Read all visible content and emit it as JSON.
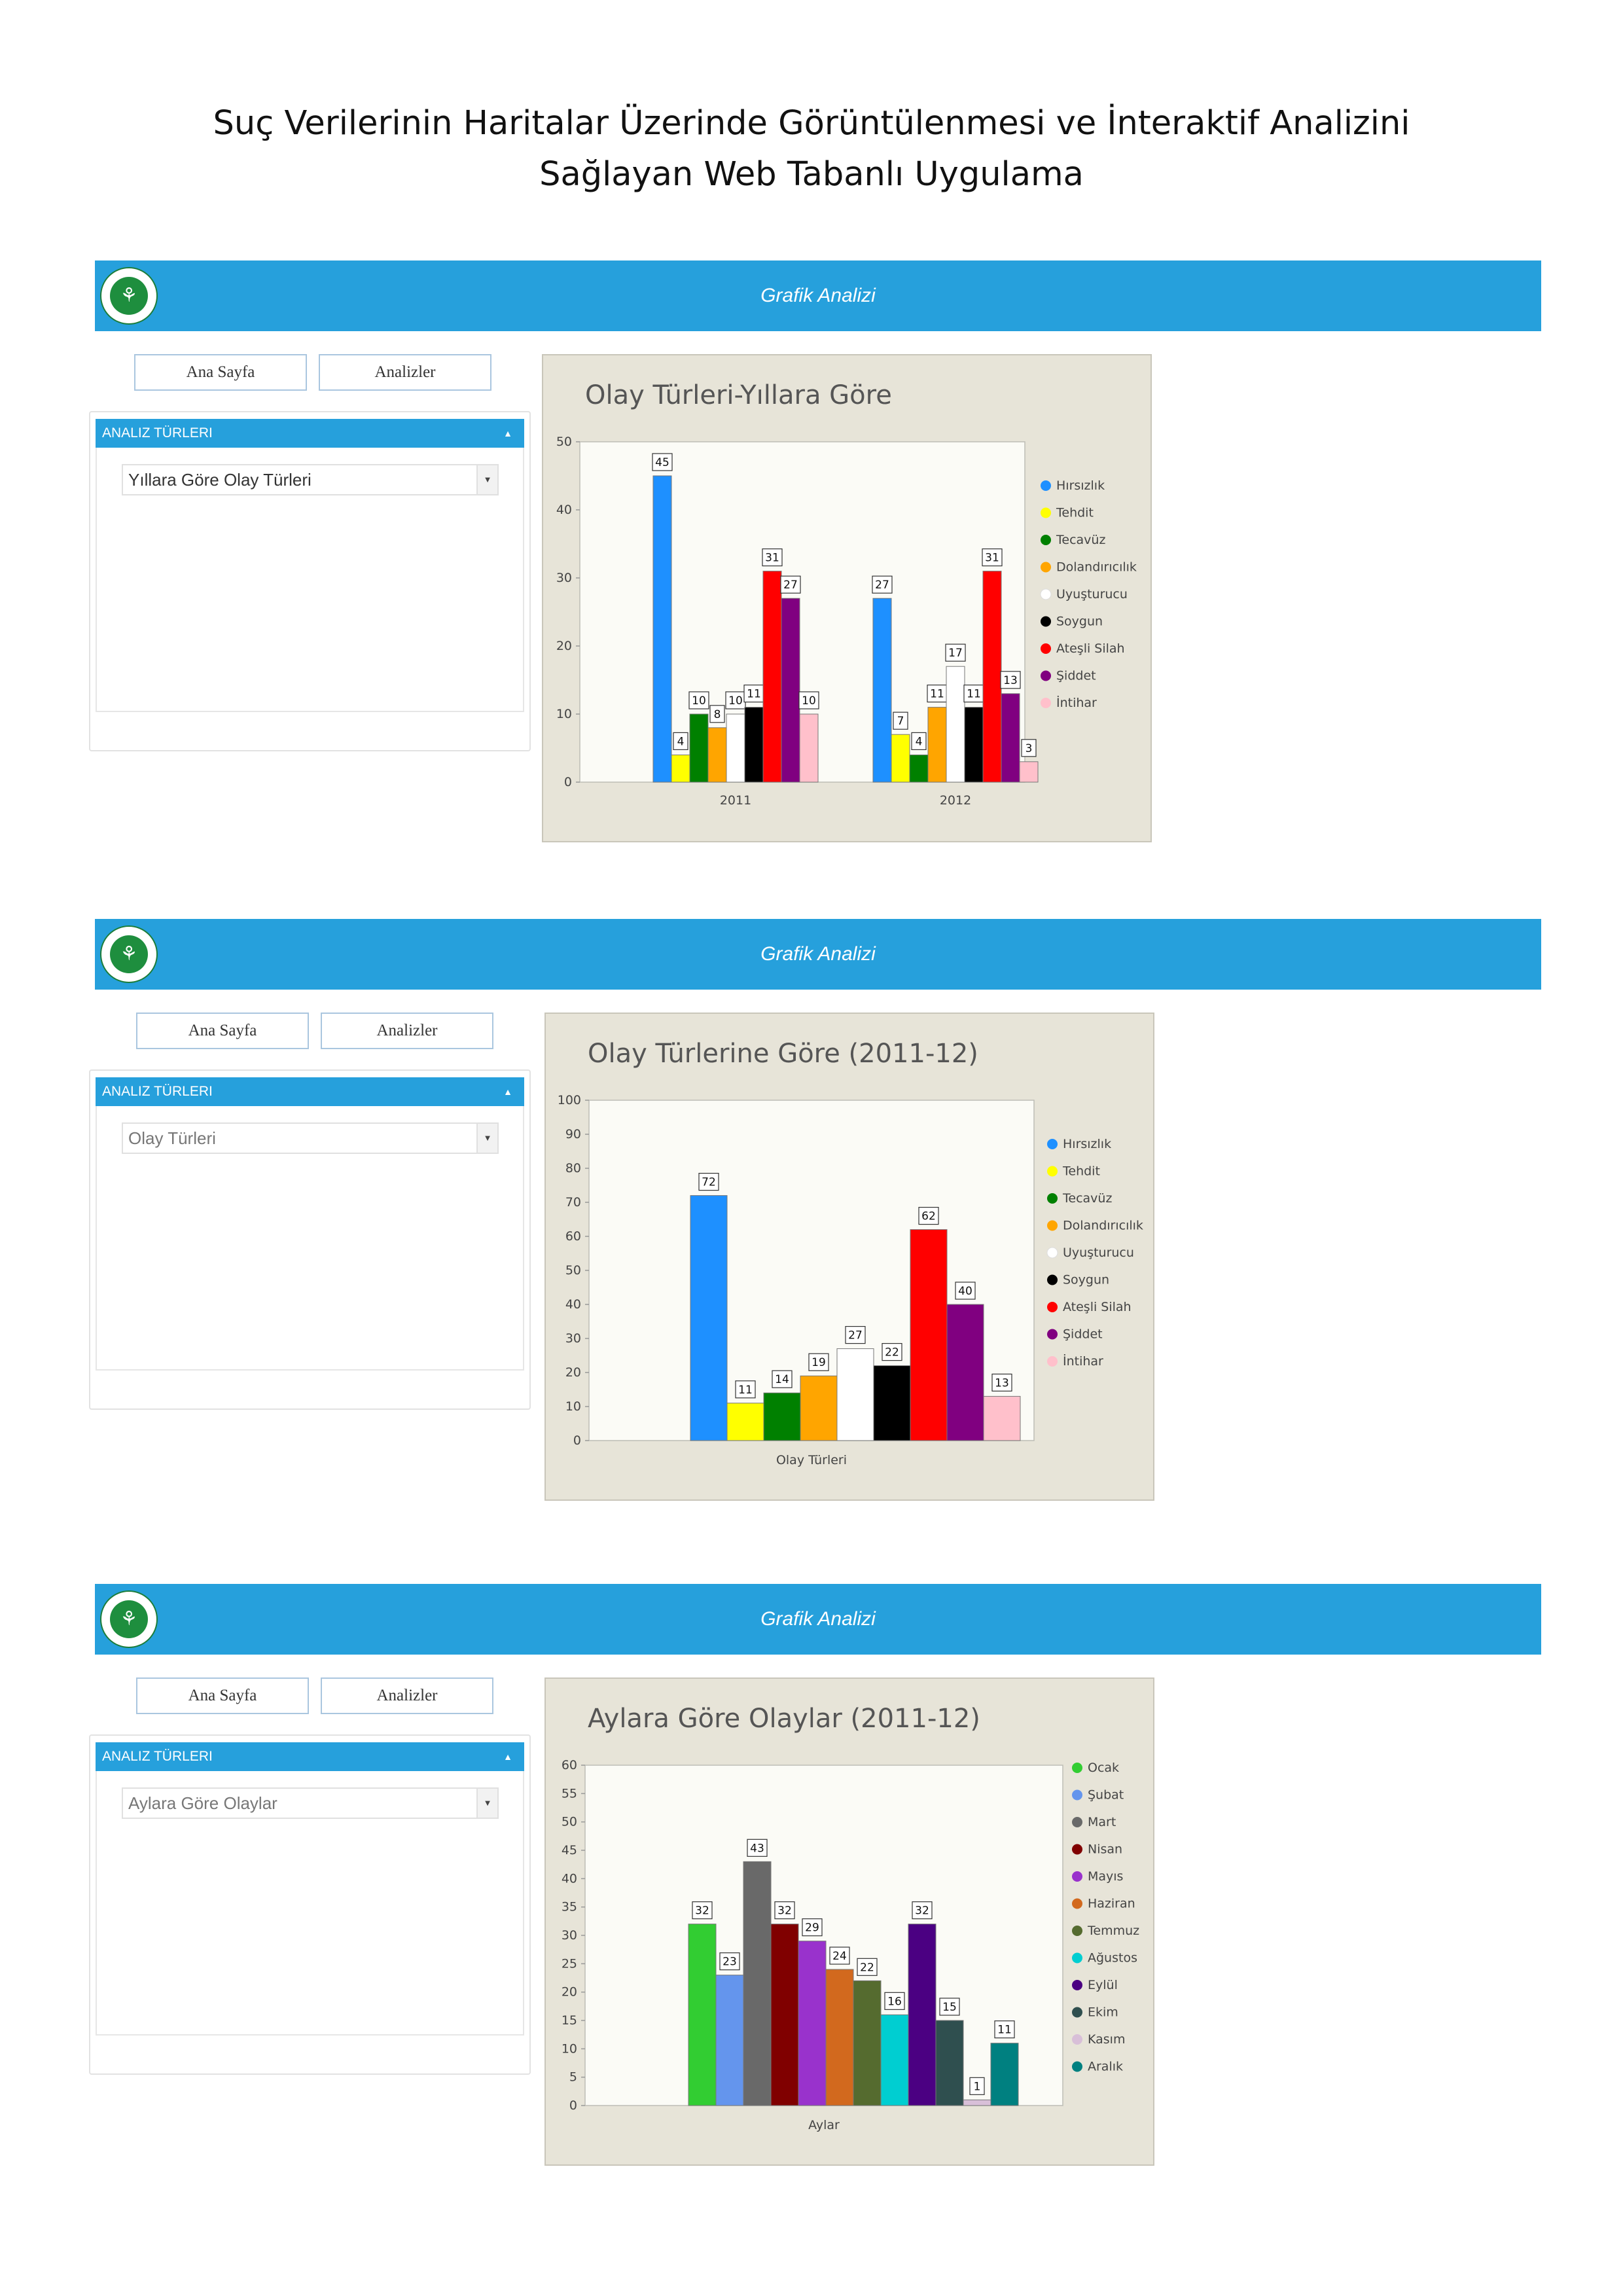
{
  "document": {
    "title_line1": "Suç Verilerinin Haritalar Üzerinde Görüntülenmesi ve İnteraktif Analizini",
    "title_line2": "Sağlayan Web Tabanlı Uygulama"
  },
  "colors": {
    "topbar": "#26a0dc",
    "sidebar_header": "#26a0dc",
    "chart_panel_bg": "#e7e4d8",
    "plot_bg": "#fbfbf6"
  },
  "icons": {
    "logo": "university-seal-icon"
  },
  "screens": [
    {
      "header_title": "Grafik Analizi",
      "nav": {
        "home_label": "Ana Sayfa",
        "analyses_label": "Analizler"
      },
      "sidebar": {
        "header": "ANALIZ TÜRLERI",
        "selected": "Yıllara Göre Olay Türleri"
      }
    },
    {
      "header_title": "Grafik Analizi",
      "nav": {
        "home_label": "Ana Sayfa",
        "analyses_label": "Analizler"
      },
      "sidebar": {
        "header": "ANALIZ TÜRLERI",
        "selected": "Olay Türleri"
      }
    },
    {
      "header_title": "Grafik Analizi",
      "nav": {
        "home_label": "Ana Sayfa",
        "analyses_label": "Analizler"
      },
      "sidebar": {
        "header": "ANALIZ TÜRLERI",
        "selected": "Aylara Göre Olaylar"
      }
    }
  ],
  "chart_data": [
    {
      "type": "bar",
      "title": "Olay Türleri-Yıllara Göre",
      "xlabel": "",
      "ylabel": "",
      "ylim": [
        0,
        50
      ],
      "yticks": [
        0,
        10,
        20,
        30,
        40,
        50
      ],
      "categories": [
        "2011",
        "2012"
      ],
      "legend_position": "right",
      "data_labels": true,
      "series": [
        {
          "name": "Hırsızlık",
          "color": "#1e90ff",
          "values": [
            45,
            27
          ]
        },
        {
          "name": "Tehdit",
          "color": "#ffff00",
          "values": [
            4,
            7
          ]
        },
        {
          "name": "Tecavüz",
          "color": "#008000",
          "values": [
            10,
            4
          ]
        },
        {
          "name": "Dolandırıcılık",
          "color": "#ffa500",
          "values": [
            8,
            11
          ]
        },
        {
          "name": "Uyuşturucu",
          "color": "#ffffff",
          "values": [
            10,
            17
          ]
        },
        {
          "name": "Soygun",
          "color": "#000000",
          "values": [
            11,
            11
          ]
        },
        {
          "name": "Ateşli Silah",
          "color": "#ff0000",
          "values": [
            31,
            31
          ]
        },
        {
          "name": "Şiddet",
          "color": "#800080",
          "values": [
            27,
            13
          ]
        },
        {
          "name": "İntihar",
          "color": "#ffc0cb",
          "values": [
            10,
            3
          ]
        }
      ]
    },
    {
      "type": "bar",
      "title": "Olay Türlerine Göre (2011-12)",
      "xlabel": "Olay Türleri",
      "ylabel": "",
      "ylim": [
        0,
        100
      ],
      "yticks": [
        0,
        10,
        20,
        30,
        40,
        50,
        60,
        70,
        80,
        90,
        100
      ],
      "categories": [
        ""
      ],
      "legend_position": "right",
      "data_labels": true,
      "series": [
        {
          "name": "Hırsızlık",
          "color": "#1e90ff",
          "values": [
            72
          ]
        },
        {
          "name": "Tehdit",
          "color": "#ffff00",
          "values": [
            11
          ]
        },
        {
          "name": "Tecavüz",
          "color": "#008000",
          "values": [
            14
          ]
        },
        {
          "name": "Dolandırıcılık",
          "color": "#ffa500",
          "values": [
            19
          ]
        },
        {
          "name": "Uyuşturucu",
          "color": "#ffffff",
          "values": [
            27
          ]
        },
        {
          "name": "Soygun",
          "color": "#000000",
          "values": [
            22
          ]
        },
        {
          "name": "Ateşli Silah",
          "color": "#ff0000",
          "values": [
            62
          ]
        },
        {
          "name": "Şiddet",
          "color": "#800080",
          "values": [
            40
          ]
        },
        {
          "name": "İntihar",
          "color": "#ffc0cb",
          "values": [
            13
          ]
        }
      ]
    },
    {
      "type": "bar",
      "title": "Aylara Göre Olaylar (2011-12)",
      "xlabel": "Aylar",
      "ylabel": "",
      "ylim": [
        0,
        60
      ],
      "yticks": [
        0,
        5,
        10,
        15,
        20,
        25,
        30,
        35,
        40,
        45,
        50,
        55,
        60
      ],
      "categories": [
        ""
      ],
      "legend_position": "right",
      "data_labels": true,
      "series": [
        {
          "name": "Ocak",
          "color": "#32cd32",
          "values": [
            32
          ]
        },
        {
          "name": "Şubat",
          "color": "#6495ed",
          "values": [
            23
          ]
        },
        {
          "name": "Mart",
          "color": "#696969",
          "values": [
            43
          ]
        },
        {
          "name": "Nisan",
          "color": "#800000",
          "values": [
            32
          ]
        },
        {
          "name": "Mayıs",
          "color": "#9932cc",
          "values": [
            29
          ]
        },
        {
          "name": "Haziran",
          "color": "#d2691e",
          "values": [
            24
          ]
        },
        {
          "name": "Temmuz",
          "color": "#556b2f",
          "values": [
            22
          ]
        },
        {
          "name": "Ağustos",
          "color": "#00ced1",
          "values": [
            16
          ]
        },
        {
          "name": "Eylül",
          "color": "#4b0082",
          "values": [
            32
          ]
        },
        {
          "name": "Ekim",
          "color": "#2f4f4f",
          "values": [
            15
          ]
        },
        {
          "name": "Kasım",
          "color": "#d8bfd8",
          "values": [
            1
          ]
        },
        {
          "name": "Aralık",
          "color": "#008080",
          "values": [
            11
          ]
        }
      ]
    }
  ]
}
